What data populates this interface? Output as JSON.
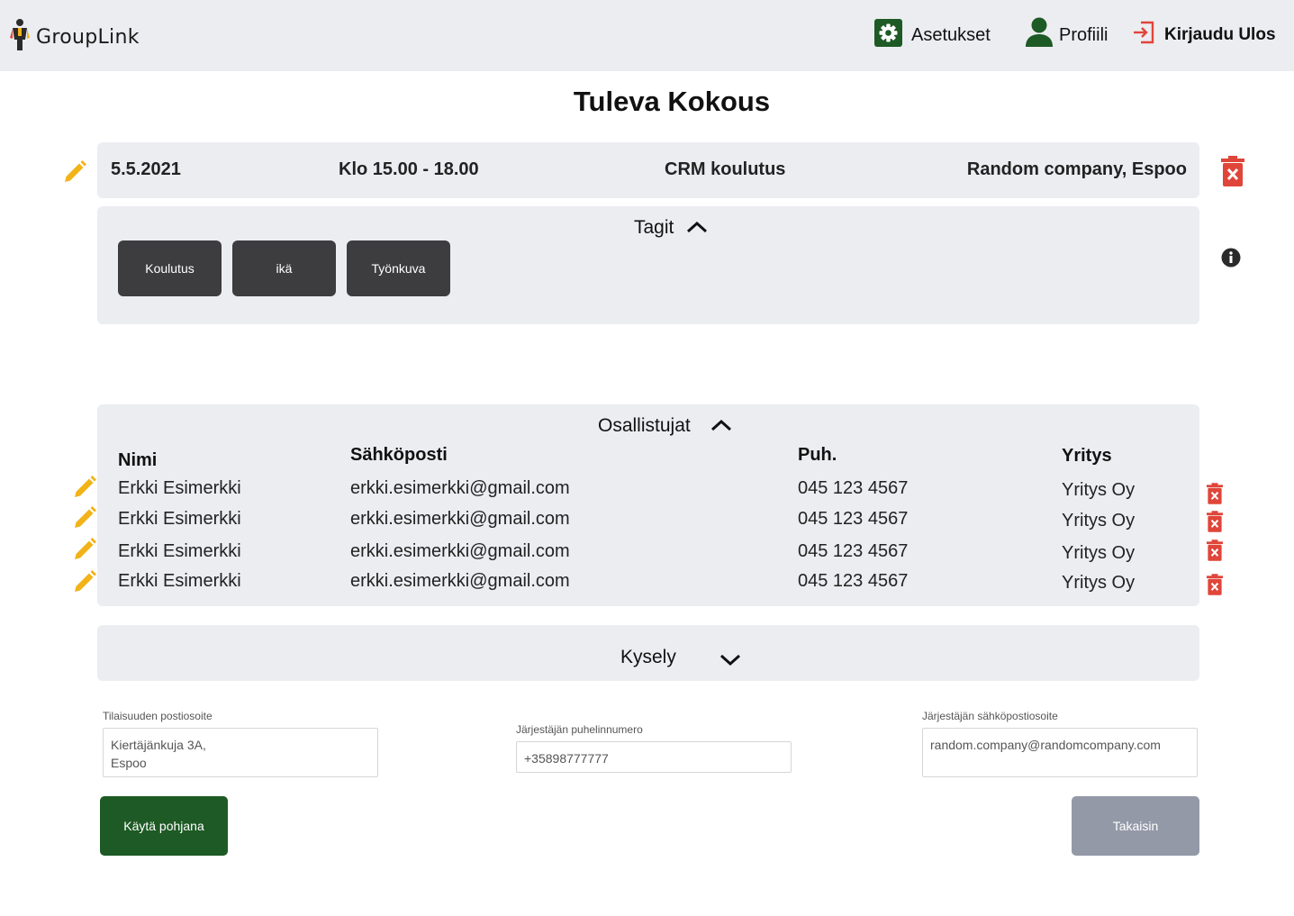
{
  "header": {
    "app_name": "GroupLink",
    "nav": {
      "settings_label": "Asetukset",
      "profile_label": "Profiili",
      "logout_label": "Kirjaudu Ulos"
    }
  },
  "page": {
    "title": "Tuleva Kokous"
  },
  "meeting": {
    "date": "5.5.2021",
    "time": "Klo 15.00 - 18.00",
    "topic": "CRM koulutus",
    "location": "Random company, Espoo"
  },
  "tags": {
    "heading": "Tagit",
    "items": [
      "Koulutus",
      "ikä",
      "Työnkuva"
    ]
  },
  "participants": {
    "heading": "Osallistujat",
    "columns": [
      "Nimi",
      "Sähköposti",
      "Puh.",
      "Yritys"
    ],
    "rows": [
      {
        "name": "Erkki Esimerkki",
        "email": "erkki.esimerkki@gmail.com",
        "phone": "045 123 4567",
        "company": "Yritys Oy"
      },
      {
        "name": "Erkki Esimerkki",
        "email": "erkki.esimerkki@gmail.com",
        "phone": "045 123 4567",
        "company": "Yritys Oy"
      },
      {
        "name": "Erkki Esimerkki",
        "email": "erkki.esimerkki@gmail.com",
        "phone": "045 123 4567",
        "company": "Yritys Oy"
      },
      {
        "name": "Erkki Esimerkki",
        "email": "erkki.esimerkki@gmail.com",
        "phone": "045 123 4567",
        "company": "Yritys Oy"
      }
    ]
  },
  "survey": {
    "heading": "Kysely"
  },
  "form": {
    "address_label": "Tilaisuuden postiosoite",
    "address_value": "Kiertäjänkuja 3A,\nEspoo",
    "phone_label": "Järjestäjän puhelinnumero",
    "phone_value": "+35898777777",
    "email_label": "Järjestäjän sähköpostiosoite",
    "email_value": "random.company@randomcompany.com"
  },
  "buttons": {
    "use_template_label": "Käytä pohjana",
    "back_label": "Takaisin"
  },
  "colors": {
    "accent_green": "#1e5a25",
    "edit_yellow": "#f2b318",
    "delete_red": "#e0453a",
    "panel_gray": "#ecedf1",
    "tag_dark": "#3d3d3f",
    "back_gray": "#9499a8"
  }
}
